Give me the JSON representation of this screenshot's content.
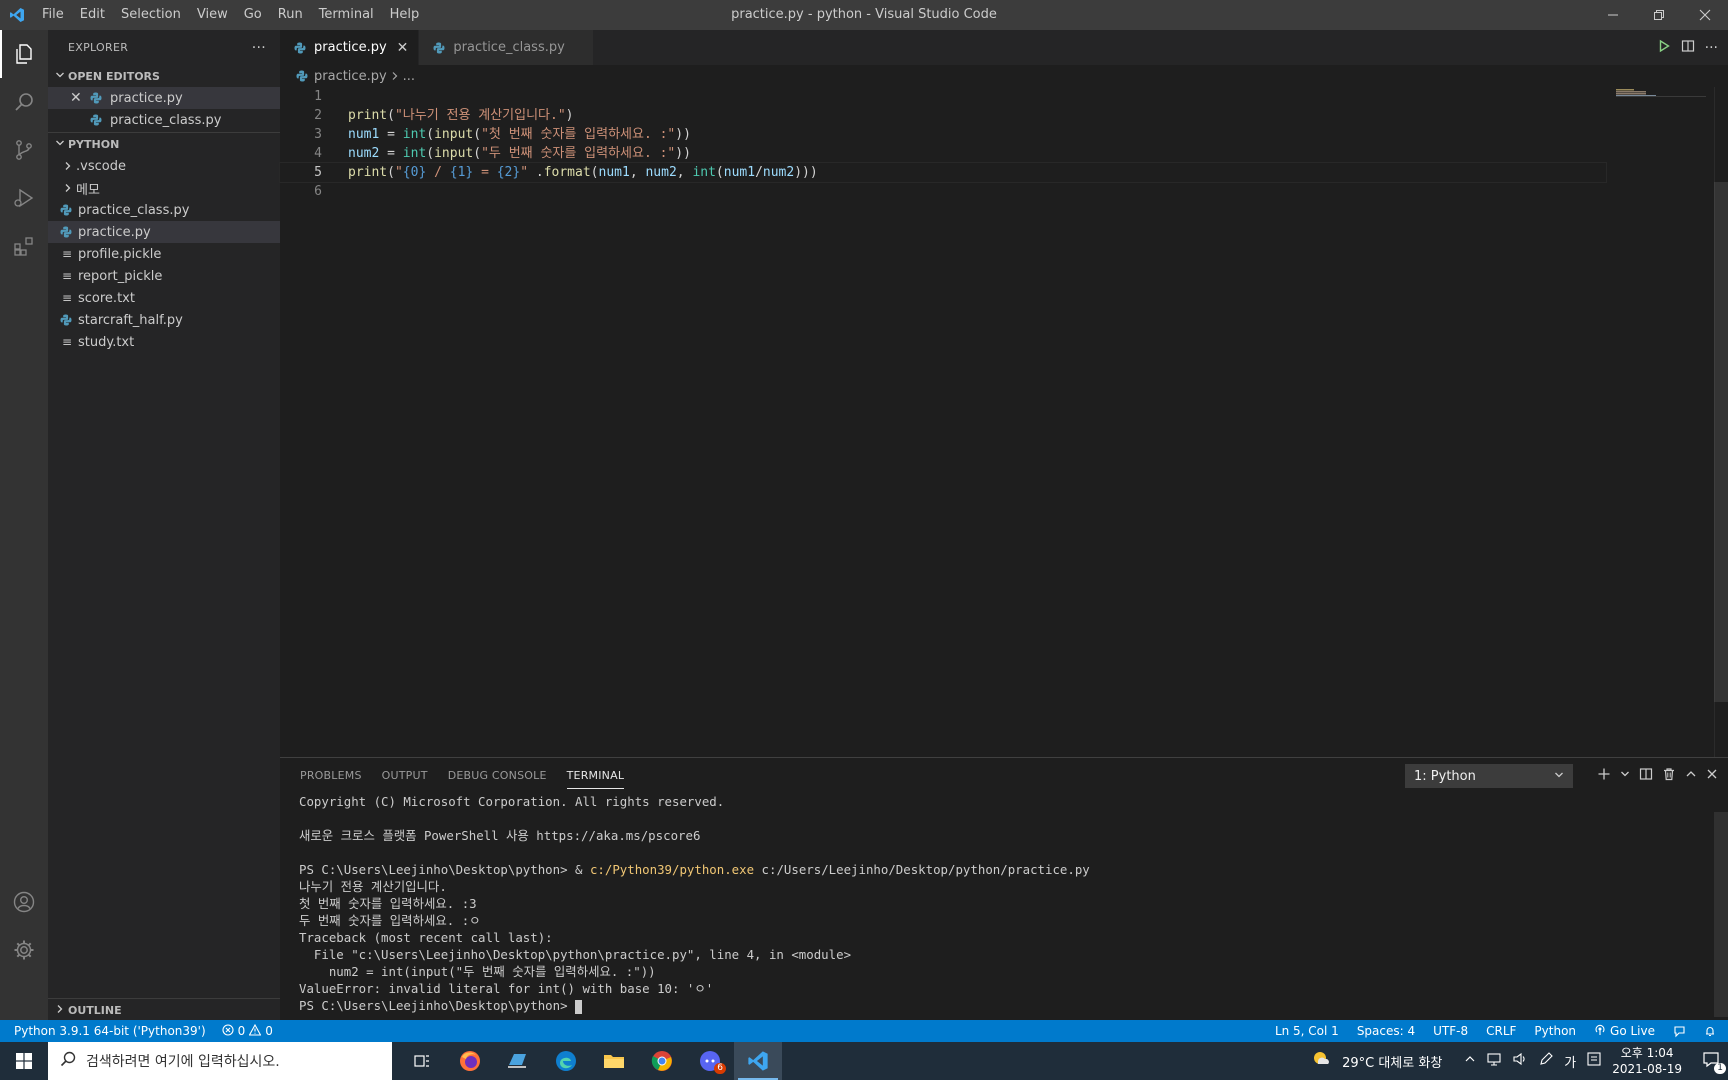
{
  "titlebar": {
    "menu": [
      "File",
      "Edit",
      "Selection",
      "View",
      "Go",
      "Run",
      "Terminal",
      "Help"
    ],
    "window_title": "practice.py - python - Visual Studio Code"
  },
  "sidebar": {
    "title": "EXPLORER",
    "open_editors_header": "OPEN EDITORS",
    "open_editors": [
      {
        "label": "practice.py"
      },
      {
        "label": "practice_class.py"
      }
    ],
    "folder_header": "PYTHON",
    "folder_items": [
      {
        "label": ".vscode",
        "kind": "folder"
      },
      {
        "label": "메모",
        "kind": "folder"
      },
      {
        "label": "practice_class.py",
        "kind": "python"
      },
      {
        "label": "practice.py",
        "kind": "python"
      },
      {
        "label": "profile.pickle",
        "kind": "text"
      },
      {
        "label": "report_pickle",
        "kind": "text"
      },
      {
        "label": "score.txt",
        "kind": "text"
      },
      {
        "label": "starcraft_half.py",
        "kind": "python"
      },
      {
        "label": "study.txt",
        "kind": "text"
      }
    ],
    "outline_header": "OUTLINE"
  },
  "editor": {
    "tabs": [
      {
        "label": "practice.py"
      },
      {
        "label": "practice_class.py"
      }
    ],
    "breadcrumb": {
      "file": "practice.py",
      "more": "..."
    },
    "line_numbers": [
      "1",
      "2",
      "3",
      "4",
      "5",
      "6"
    ],
    "lines": {
      "l2": {
        "fn": "print",
        "open": "(",
        "str": "\"나누기 전용 계산기입니다.\"",
        "close": ")"
      },
      "l3": {
        "var": "num1",
        "eq": " = ",
        "cls": "int",
        "p1": "(",
        "fn": "input",
        "p2": "(",
        "str": "\"첫 번째 숫자를 입력하세요. :\"",
        "close": "))"
      },
      "l4": {
        "var": "num2",
        "eq": " = ",
        "cls": "int",
        "p1": "(",
        "fn": "input",
        "p2": "(",
        "str": "\"두 번째 숫자를 입력하세요. :\"",
        "close": "))"
      },
      "l5": {
        "fn": "print",
        "open": "(",
        "q1": "\"",
        "f0": "{0}",
        "s1": " / ",
        "f1": "{1}",
        "s2": " = ",
        "f2": "{2}",
        "q2": "\"",
        "dot": " .",
        "fn2": "format",
        "p1": "(",
        "a1": "num1",
        "c1": ", ",
        "a2": "num2",
        "c2": ", ",
        "cls": "int",
        "p2": "(",
        "a3": "num1",
        "slash": "/",
        "a4": "num2",
        "close": ")))"
      }
    }
  },
  "panel": {
    "tabs": [
      "PROBLEMS",
      "OUTPUT",
      "DEBUG CONSOLE",
      "TERMINAL"
    ],
    "terminal_select": "1: Python",
    "terminal": {
      "t1": "Copyright (C) Microsoft Corporation. All rights reserved.",
      "t2": "",
      "t3": "새로운 크로스 플랫폼 PowerShell 사용 https://aka.ms/pscore6",
      "t4": "",
      "t5_prompt": "PS C:\\Users\\Leejinho\\Desktop\\python> & ",
      "t5_exe": "c:/Python39/python.exe",
      "t5_rest": " c:/Users/Leejinho/Desktop/python/practice.py",
      "t6": "나누기 전용 계산기입니다.",
      "t7": "첫 번째 숫자를 입력하세요. :3",
      "t8": "두 번째 숫자를 입력하세요. :ㅇ",
      "t9": "Traceback (most recent call last):",
      "t10": "  File \"c:\\Users\\Leejinho\\Desktop\\python\\practice.py\", line 4, in <module>",
      "t11": "    num2 = int(input(\"두 번째 숫자를 입력하세요. :\"))",
      "t12": "ValueError: invalid literal for int() with base 10: 'ㅇ'",
      "t13": "PS C:\\Users\\Leejinho\\Desktop\\python> "
    }
  },
  "statusbar": {
    "interpreter": "Python 3.9.1 64-bit ('Python39')",
    "errors": "0",
    "warnings": "0",
    "position": "Ln 5, Col 1",
    "spaces": "Spaces: 4",
    "encoding": "UTF-8",
    "eol": "CRLF",
    "language": "Python",
    "golive": "Go Live"
  },
  "taskbar": {
    "search_placeholder": "검색하려면 여기에 입력하십시오.",
    "weather": "29°C  대체로 화창",
    "ime": "가",
    "time": "오후 1:04",
    "date": "2021-08-19",
    "notifications": "1",
    "discord_badge": "6"
  },
  "colors": {
    "accent": "#007acc",
    "activitybar": "#333333",
    "sidebar": "#252526",
    "editor_bg": "#1e1e1e",
    "python_icon": "#519aba"
  }
}
